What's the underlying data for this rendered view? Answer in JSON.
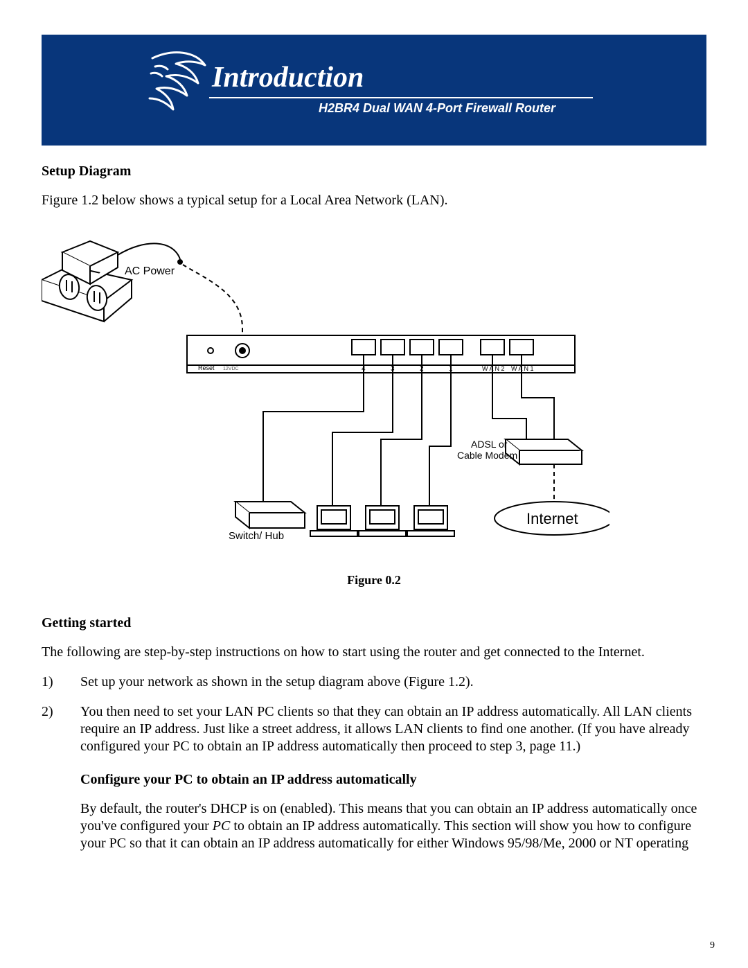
{
  "banner": {
    "title": "Introduction",
    "subtitle": "H2BR4  Dual WAN 4-Port Firewall Router"
  },
  "section1_heading": "Setup Diagram",
  "section1_text": "Figure 1.2 below shows a typical setup for a Local Area Network (LAN).",
  "figure": {
    "caption": "Figure 0.2",
    "labels": {
      "ac_power": "AC Power",
      "reset": "Reset",
      "volts": "12VDC",
      "port4": "4",
      "port3": "3",
      "port2": "2",
      "port1": "1",
      "wan2": "W A N 2",
      "wan1": "W A N 1",
      "modem1": "ADSL or",
      "modem2": "Cable Modem",
      "switch": "Switch/ Hub",
      "internet": "Internet"
    }
  },
  "section2_heading": "Getting started",
  "section2_intro": "The following are step-by-step instructions on how to start using the router and get connected to the Internet.",
  "steps": [
    {
      "n": "1)",
      "text": "Set up your network as shown in the setup diagram above (Figure 1.2)."
    },
    {
      "n": "2)",
      "text": "You then need to set your LAN PC clients so that they can obtain an IP address automatically.  All LAN clients require an IP address.  Just like a street address, it allows LAN clients to find one another.  (If you have already configured your PC to obtain an IP address automatically then proceed to step 3, page 11.)"
    }
  ],
  "sub_heading": "Configure your PC to obtain an IP address automatically",
  "sub_text_a": "By default, the router's DHCP is on (enabled).  This means that you can obtain an IP address automatically once you've configured your ",
  "sub_text_em": "PC",
  "sub_text_b": " to obtain an IP address automatically. This section will show you how to configure your PC so that it can obtain an IP address automatically for either Windows 95/98/Me, 2000 or NT operating",
  "page_number": "9"
}
